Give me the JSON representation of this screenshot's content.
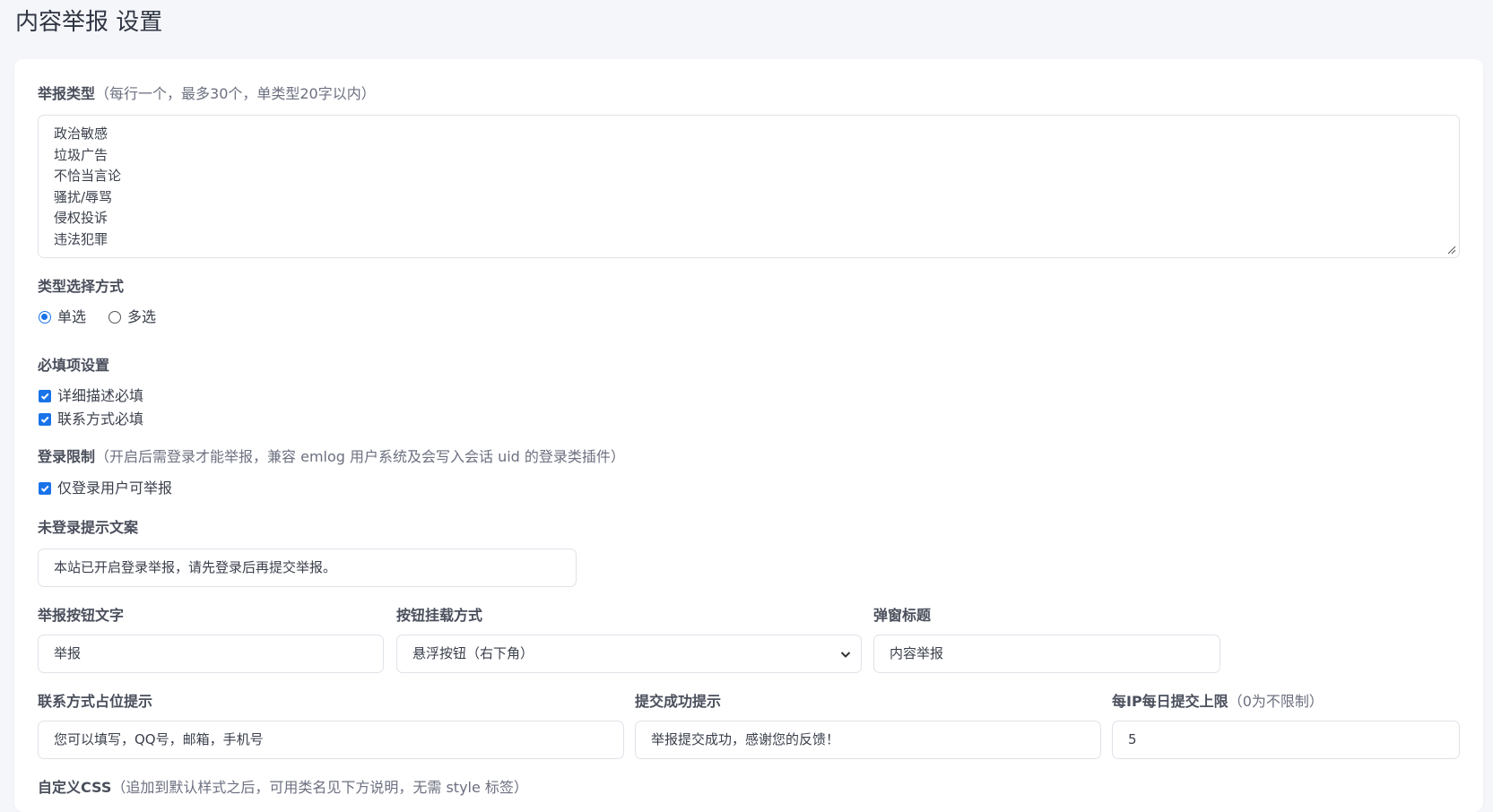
{
  "page": {
    "title": "内容举报 设置"
  },
  "types": {
    "label": "举报类型",
    "hint": "（每行一个，最多30个，单类型20字以内）",
    "lines": [
      "政治敏感",
      "垃圾广告",
      "不恰当言论",
      "骚扰/辱骂",
      "侵权投诉",
      "违法犯罪"
    ]
  },
  "select_mode": {
    "label": "类型选择方式",
    "options": [
      {
        "label": "单选",
        "selected": true
      },
      {
        "label": "多选",
        "selected": false
      }
    ]
  },
  "required": {
    "label": "必填项设置",
    "items": [
      {
        "label": "详细描述必填",
        "checked": true
      },
      {
        "label": "联系方式必填",
        "checked": true
      }
    ]
  },
  "login": {
    "label": "登录限制",
    "hint": "（开启后需登录才能举报，兼容 emlog 用户系统及会写入会话 uid 的登录类插件）",
    "checkbox_label": "仅登录用户可举报",
    "checked": true
  },
  "login_tip": {
    "label": "未登录提示文案",
    "value": "本站已开启登录举报，请先登录后再提交举报。"
  },
  "button_text": {
    "label": "举报按钮文字",
    "value": "举报"
  },
  "button_mount": {
    "label": "按钮挂载方式",
    "value": "悬浮按钮（右下角）"
  },
  "popup_title": {
    "label": "弹窗标题",
    "value": "内容举报"
  },
  "contact_placeholder": {
    "label": "联系方式占位提示",
    "value": "您可以填写，QQ号，邮箱，手机号"
  },
  "success_tip": {
    "label": "提交成功提示",
    "value": "举报提交成功，感谢您的反馈！"
  },
  "ip_limit": {
    "label": "每IP每日提交上限",
    "hint": "（0为不限制）",
    "value": "5"
  },
  "custom_css": {
    "label": "自定义CSS",
    "hint": "（追加到默认样式之后，可用类名见下方说明，无需 style 标签）"
  },
  "colors": {
    "accent": "#1a73e8",
    "card": "#ffffff",
    "background": "#f5f6fa",
    "border": "#dfe2e8"
  }
}
